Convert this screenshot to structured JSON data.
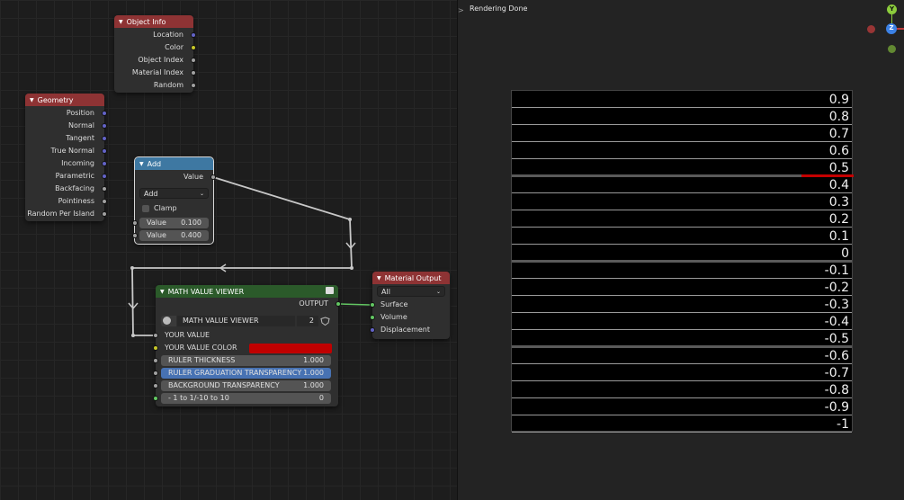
{
  "viewport": {
    "status": "Rendering Done",
    "panel_toggle_glyph": ">"
  },
  "nodes": {
    "object_info": {
      "title": "Object Info",
      "outputs": [
        "Location",
        "Color",
        "Object Index",
        "Material Index",
        "Random"
      ]
    },
    "geometry": {
      "title": "Geometry",
      "outputs": [
        "Position",
        "Normal",
        "Tangent",
        "True Normal",
        "Incoming",
        "Parametric",
        "Backfacing",
        "Pointiness",
        "Random Per Island"
      ]
    },
    "add": {
      "title": "Add",
      "output_label": "Value",
      "operation": "Add",
      "clamp_label": "Clamp",
      "inputs": [
        {
          "label": "Value",
          "value": "0.100"
        },
        {
          "label": "Value",
          "value": "0.400"
        }
      ]
    },
    "math_viewer": {
      "title": "MATH VALUE VIEWER",
      "output_label": "OUTPUT",
      "group_name": "MATH VALUE VIEWER",
      "users": "2",
      "your_value_label": "YOUR VALUE",
      "your_value_color_label": "YOUR VALUE COLOR",
      "your_value_color": "#c00000",
      "fields": [
        {
          "label": "RULER THICKNESS",
          "value": "1.000"
        },
        {
          "label": "RULER GRADUATION TRANSPARENCY",
          "value": "1.000"
        },
        {
          "label": "BACKGROUND TRANSPARENCY",
          "value": "1.000"
        },
        {
          "label": "- 1 to 1/-10 to 10",
          "value": "0"
        }
      ]
    },
    "material_output": {
      "title": "Material Output",
      "target": "All",
      "inputs": [
        "Surface",
        "Volume",
        "Displacement"
      ]
    }
  },
  "ruler": {
    "labels": [
      "0.9",
      "0.8",
      "0.7",
      "0.6",
      "0.5",
      "0.4",
      "0.3",
      "0.2",
      "0.1",
      "0",
      "-0.1",
      "-0.2",
      "-0.3",
      "-0.4",
      "-0.5",
      "-0.6",
      "-0.7",
      "-0.8",
      "-0.9",
      "-1"
    ],
    "displayed_value": 0.5,
    "marker_color": "#c40000"
  },
  "gizmo": {
    "y_label": "Y",
    "z_label": "Z",
    "x_color": "#c03c3c",
    "y_color": "#8ccd3c",
    "z_color": "#3c82e6"
  }
}
